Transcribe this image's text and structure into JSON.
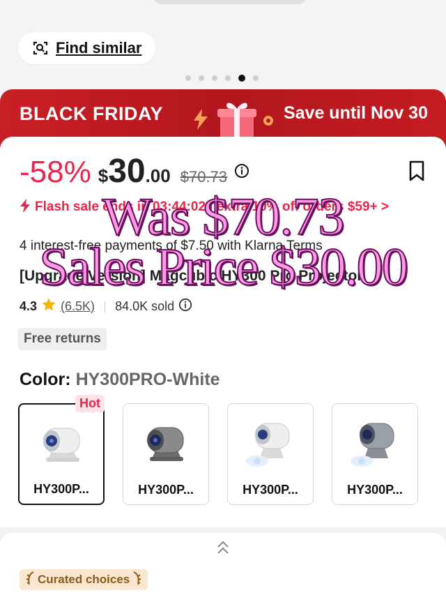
{
  "find_similar": {
    "label": "Find similar"
  },
  "carousel": {
    "total": 6,
    "active_index": 4
  },
  "banner": {
    "left": "BLACK FRIDAY",
    "right": "Save until Nov 30"
  },
  "price": {
    "discount": "-58%",
    "currency": "$",
    "integer": "30",
    "decimal": ".00",
    "original": "$70.73"
  },
  "flash": {
    "text": "Flash sale ends in 03:44:02 | extra 10% off orders $59+ >"
  },
  "installments": {
    "text": "4 interest-free payments of $7.50 with Klarna Terms"
  },
  "product": {
    "title": "[Upgrade Version] Magcubic HY300 Pro Projector"
  },
  "rating": {
    "score": "4.3",
    "reviews": "(6.5K)",
    "sold": "84.0K sold"
  },
  "free_returns": "Free returns",
  "color": {
    "label": "Color:",
    "value": "HY300PRO-White",
    "hot_badge": "Hot",
    "options": [
      {
        "name": "HY300P...",
        "variant": "white"
      },
      {
        "name": "HY300P...",
        "variant": "gray"
      },
      {
        "name": "HY300P...",
        "variant": "white-light"
      },
      {
        "name": "HY300P...",
        "variant": "gray-light"
      }
    ]
  },
  "bottom": {
    "curated": "Curated choices"
  },
  "overlay": {
    "was": "Was $70.73",
    "sale": "Sales Price $30.00"
  },
  "colors": {
    "brand_red": "#c91f26",
    "sale_pink": "#e8254a",
    "overlay_pink": "#ff9be6"
  }
}
